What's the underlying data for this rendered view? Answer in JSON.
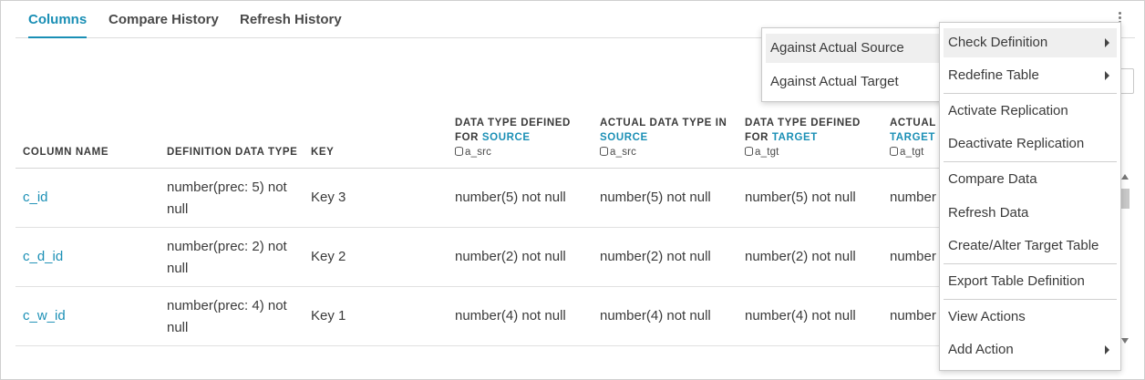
{
  "tabs": [
    {
      "label": "Columns",
      "active": true
    },
    {
      "label": "Compare History",
      "active": false
    },
    {
      "label": "Refresh History",
      "active": false
    }
  ],
  "table": {
    "headers": {
      "column_name": "COLUMN NAME",
      "definition_data_type": "DEFINITION DATA TYPE",
      "key": "KEY",
      "defined_source": {
        "line1": "DATA TYPE DEFINED",
        "line2_prefix": "FOR ",
        "line2_highlight": "SOURCE",
        "db": "a_src"
      },
      "actual_source": {
        "line1": "ACTUAL DATA TYPE IN",
        "line2_highlight": "SOURCE",
        "db": "a_src"
      },
      "defined_target": {
        "line1": "DATA TYPE DEFINED",
        "line2_prefix": "FOR ",
        "line2_highlight": "TARGET",
        "db": "a_tgt"
      },
      "actual_target": {
        "line1": "ACTUAL D",
        "line2_highlight": "TARGET",
        "db": "a_tgt"
      }
    },
    "rows": [
      {
        "name": "c_id",
        "def_line1": "number(prec: 5) not",
        "def_line2": "null",
        "key": "Key 3",
        "def_src": "number(5) not null",
        "act_src": "number(5) not null",
        "def_tgt": "number(5) not null",
        "act_tgt": "number"
      },
      {
        "name": "c_d_id",
        "def_line1": "number(prec: 2) not",
        "def_line2": "null",
        "key": "Key 2",
        "def_src": "number(2) not null",
        "act_src": "number(2) not null",
        "def_tgt": "number(2) not null",
        "act_tgt": "number"
      },
      {
        "name": "c_w_id",
        "def_line1": "number(prec: 4) not",
        "def_line2": "null",
        "key": "Key 1",
        "def_src": "number(4) not null",
        "act_src": "number(4) not null",
        "def_tgt": "number(4) not null",
        "act_tgt": "number"
      }
    ]
  },
  "context_menu": {
    "items": [
      {
        "label": "Check Definition",
        "submenu": true,
        "highlighted": true
      },
      {
        "label": "Redefine Table",
        "submenu": true
      },
      {
        "label": "Activate Replication"
      },
      {
        "label": "Deactivate Replication"
      },
      {
        "label": "Compare Data"
      },
      {
        "label": "Refresh Data"
      },
      {
        "label": "Create/Alter Target Table"
      },
      {
        "label": "Export Table Definition"
      },
      {
        "label": "View Actions"
      },
      {
        "label": "Add Action",
        "submenu": true
      }
    ]
  },
  "submenu": {
    "items": [
      {
        "label": "Against Actual Source",
        "highlighted": true
      },
      {
        "label": "Against Actual Target"
      }
    ]
  },
  "colors": {
    "accent": "#1a8fb5",
    "text": "#3a3a3a",
    "menu_highlight": "#efefef"
  },
  "icons": {
    "database": "database-icon",
    "more": "kebab-menu-icon"
  }
}
